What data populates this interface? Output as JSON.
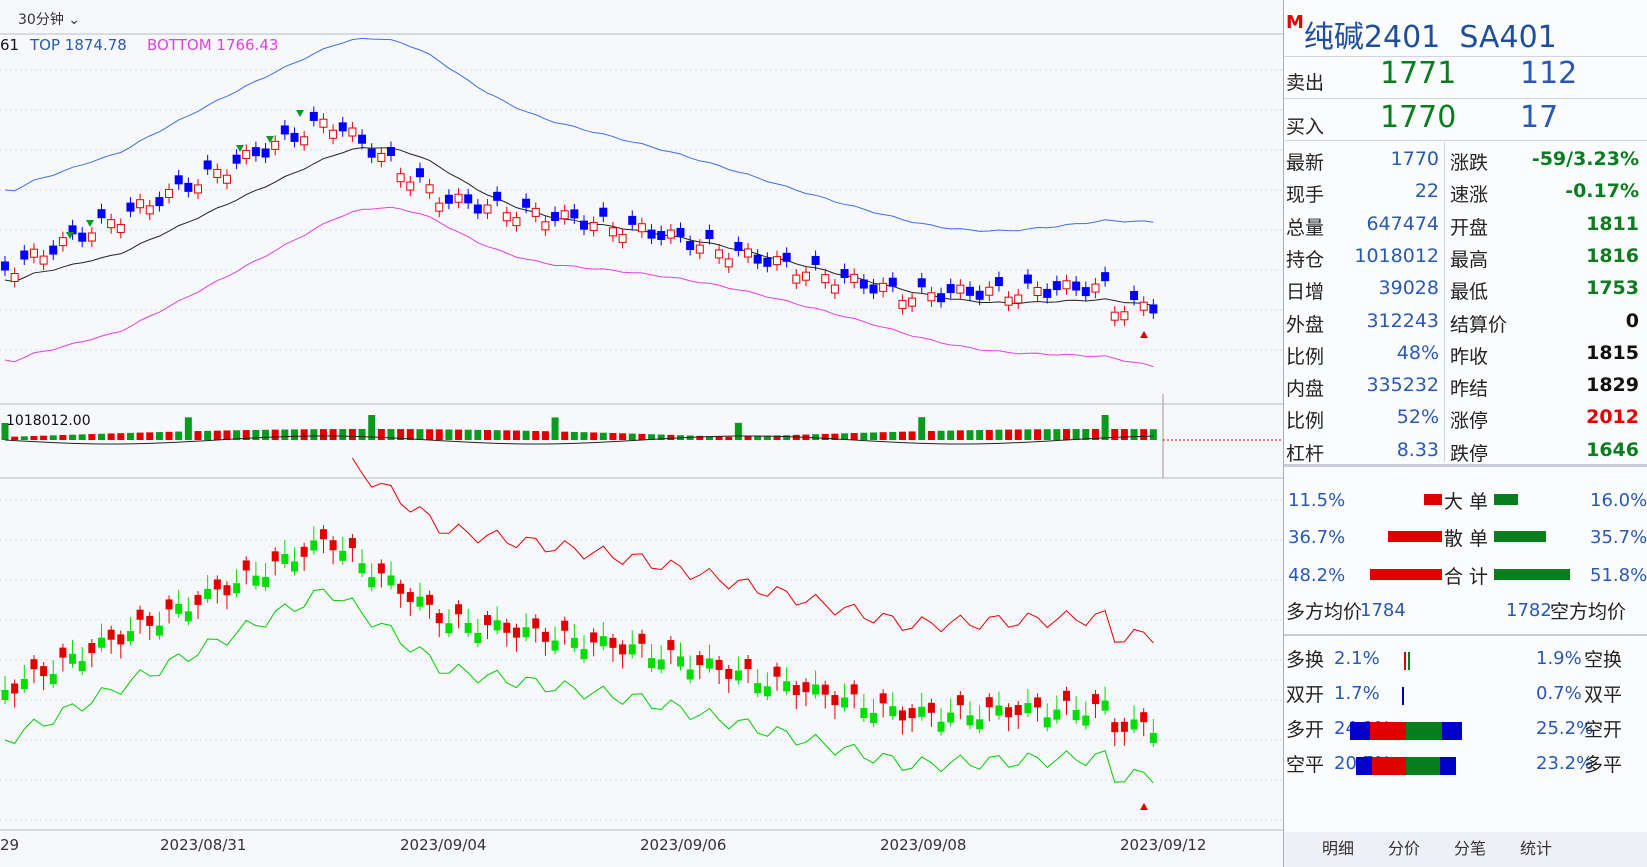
{
  "toolbar": {
    "period": "30分钟",
    "chevron": "chevron-down-icon"
  },
  "legend": {
    "prefix": "61",
    "top": "TOP 1874.78",
    "bottom": "BOTTOM 1766.43"
  },
  "volume_panel": {
    "label": "1018012.00"
  },
  "x_axis": [
    "29",
    "2023/08/31",
    "2023/09/04",
    "2023/09/06",
    "2023/09/08",
    "2023/09/12"
  ],
  "colors": {
    "up": "#e00000",
    "down": "#0000ff",
    "upper_band": "#3d6fe0",
    "lower_band": "#e040e0",
    "mid": "#222222",
    "green": "#00cc00"
  },
  "quote": {
    "marker": "M",
    "name": "纯碱2401",
    "code": "SA401",
    "sell_label": "卖出",
    "sell_price": "1771",
    "sell_qty": "112",
    "buy_label": "买入",
    "buy_price": "1770",
    "buy_qty": "17",
    "fields": [
      {
        "l1": "最新",
        "v1": "1770",
        "l2": "涨跌",
        "v2": "-59/3.23%",
        "c2": "green"
      },
      {
        "l1": "现手",
        "v1": "22",
        "l2": "速涨",
        "v2": "-0.17%",
        "c2": "green"
      },
      {
        "l1": "总量",
        "v1": "647474",
        "l2": "开盘",
        "v2": "1811",
        "c2": "green"
      },
      {
        "l1": "持仓",
        "v1": "1018012",
        "l2": "最高",
        "v2": "1816",
        "c2": "green"
      },
      {
        "l1": "日增",
        "v1": "39028",
        "l2": "最低",
        "v2": "1753",
        "c2": "green"
      },
      {
        "l1": "外盘",
        "v1": "312243",
        "l2": "结算价",
        "v2": "0",
        "c2": "black"
      },
      {
        "l1": "比例",
        "v1": "48%",
        "l2": "昨收",
        "v2": "1815",
        "c2": "black"
      },
      {
        "l1": "内盘",
        "v1": "335232",
        "l2": "昨结",
        "v2": "1829",
        "c2": "black"
      },
      {
        "l1": "比例",
        "v1": "52%",
        "l2": "涨停",
        "v2": "2012",
        "c2": "red"
      },
      {
        "l1": "杠杆",
        "v1": "8.33",
        "l2": "跌停",
        "v2": "1646",
        "c2": "green"
      }
    ]
  },
  "flow": {
    "big": {
      "left": "11.5%",
      "label": "大 单",
      "right": "16.0%"
    },
    "retail": {
      "left": "36.7%",
      "label": "散 单",
      "right": "35.7%"
    },
    "total": {
      "left": "48.2%",
      "label": "合 计",
      "right": "51.8%"
    },
    "long_avg_label": "多方均价",
    "long_avg": "1784",
    "short_avg": "1782",
    "short_avg_label": "空方均价"
  },
  "positions": [
    {
      "l": "多换",
      "lv": "2.1%",
      "rv": "1.9%",
      "r": "空换"
    },
    {
      "l": "双开",
      "lv": "1.7%",
      "rv": "0.7%",
      "r": "双平"
    },
    {
      "l": "多开",
      "lv": "24.1%",
      "rv": "25.2%",
      "r": "空开"
    },
    {
      "l": "空平",
      "lv": "20.7%",
      "rv": "23.2%",
      "r": "多平"
    }
  ],
  "tabs": [
    "明细",
    "分价",
    "分笔",
    "统计"
  ]
}
